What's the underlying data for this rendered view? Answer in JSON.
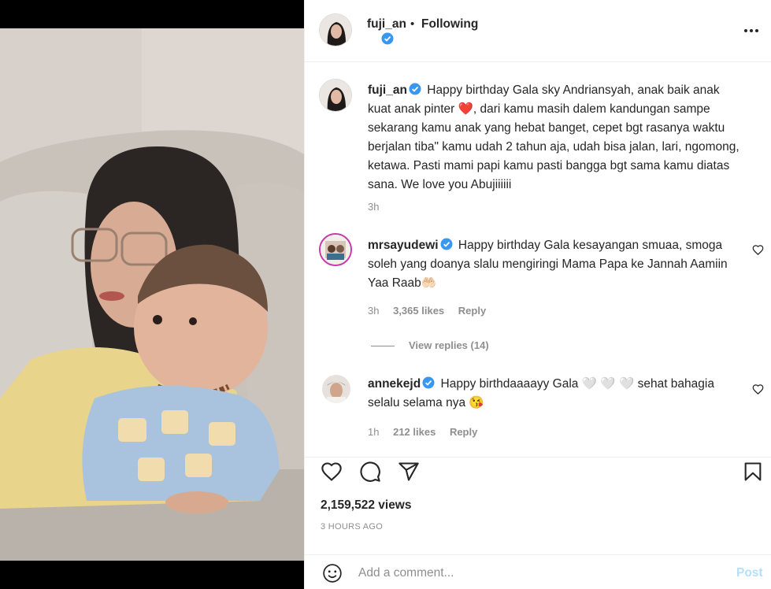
{
  "header": {
    "username": "fuji_an",
    "separator": "•",
    "follow_status": "Following"
  },
  "caption": {
    "username": "fuji_an",
    "text_before_heart": "Happy birthday Gala sky Andriansyah, anak baik anak kuat anak pinter",
    "heart_emoji": "❤️",
    "text_after_heart": ", dari kamu masih dalem kandungan sampe sekarang kamu anak yang hebat banget, cepet bgt rasanya waktu berjalan tiba\" kamu udah 2 tahun aja, udah bisa jalan, lari, ngomong, ketawa. Pasti mami papi kamu pasti bangga bgt sama kamu diatas sana. We love you Abujiiiiii",
    "time": "3h"
  },
  "comments": [
    {
      "username": "mrsayudewi",
      "text": "Happy birthday Gala kesayangan smuaa, smoga soleh yang doanya slalu mengiringi Mama Papa ke Jannah Aamiin Yaa Raab",
      "emoji": "🤲🏻",
      "time": "3h",
      "likes": "3,365 likes",
      "reply_label": "Reply",
      "view_replies": "View replies (14)"
    },
    {
      "username": "annekejd",
      "text_before": "Happy birthdaaaayy Gala",
      "hearts": "🤍 🤍 🤍",
      "text_after": "sehat bahagia selalu selama nya",
      "emoji": "😘",
      "time": "1h",
      "likes": "212 likes",
      "reply_label": "Reply"
    }
  ],
  "stats": {
    "views": "2,159,522 views",
    "post_time": "3 HOURS AGO"
  },
  "add_comment": {
    "placeholder": "Add a comment...",
    "post_label": "Post"
  },
  "colors": {
    "verified_blue": "#3897f0",
    "muted_text": "#8e8e8e",
    "post_disabled": "#b2dffc",
    "heart_red": "#e0245e"
  },
  "icons": [
    "more-icon",
    "verified-icon",
    "heart-icon",
    "comment-icon",
    "share-icon",
    "bookmark-icon",
    "emoji-icon"
  ]
}
